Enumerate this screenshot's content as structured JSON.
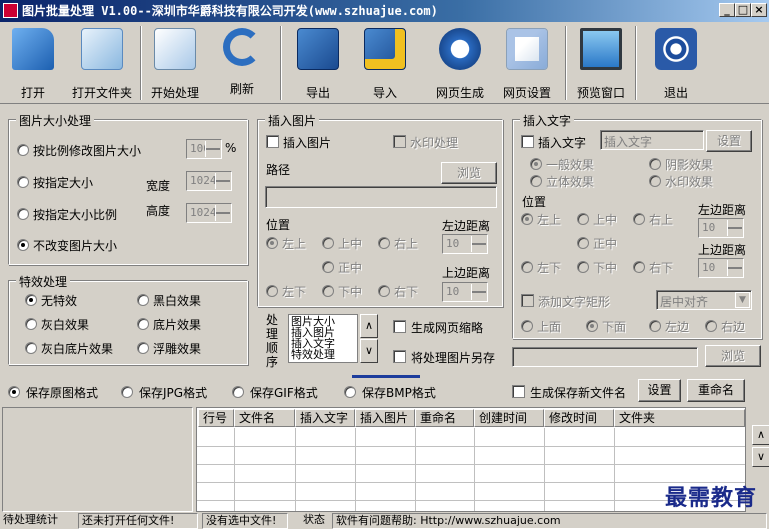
{
  "window": {
    "title": "图片批量处理 V1.00--深圳市华爵科技有限公司开发(www.szhuajue.com)"
  },
  "toolbar": [
    {
      "label": "打开",
      "icon": "open-folder-icon",
      "color": "#2a70c0"
    },
    {
      "label": "打开文件夹",
      "icon": "folder-search-icon",
      "color": "#4a90c8"
    },
    {
      "label": "开始处理",
      "icon": "process-document-icon",
      "color": "#3a7ab8"
    },
    {
      "label": "刷新",
      "icon": "refresh-icon",
      "color": "#2c6ec0"
    },
    {
      "label": "导出",
      "icon": "export-icon",
      "color": "#2a6ab0"
    },
    {
      "label": "导入",
      "icon": "import-icon",
      "color": "#2a6ab0"
    },
    {
      "label": "网页生成",
      "icon": "ie-globe-icon",
      "color": "#2060b0"
    },
    {
      "label": "网页设置",
      "icon": "ie-settings-icon",
      "color": "#2868b8"
    },
    {
      "label": "预览窗口",
      "icon": "monitor-icon",
      "color": "#3a88d0"
    },
    {
      "label": "退出",
      "icon": "exit-icon",
      "color": "#1c4c9c"
    }
  ],
  "size_group": {
    "title": "图片大小处理",
    "opt1": "按比例修改图片大小",
    "opt2": "按指定大小",
    "opt3": "按指定大小比例",
    "opt4": "不改变图片大小",
    "percent_value": "100",
    "percent_unit": "%",
    "width_label": "宽度",
    "width_value": "1024",
    "height_label": "高度",
    "height_value": "1024"
  },
  "effect_group": {
    "title": "特效处理",
    "opts": [
      "无特效",
      "黑白效果",
      "灰白效果",
      "底片效果",
      "灰白底片效果",
      "浮雕效果"
    ]
  },
  "insert_image": {
    "title": "插入图片",
    "checkbox": "插入图片",
    "watermark": "水印处理",
    "path_label": "路径",
    "browse": "浏览",
    "position_label": "位置",
    "positions": [
      "左上",
      "上中",
      "右上",
      "正中",
      "左下",
      "下中",
      "右下"
    ],
    "left_margin_label": "左边距离",
    "left_margin_value": "10",
    "top_margin_label": "上边距离",
    "top_margin_value": "10"
  },
  "insert_text": {
    "title": "插入文字",
    "checkbox": "插入文字",
    "placeholder": "插入文字",
    "settings": "设置",
    "effects": [
      "一般效果",
      "阴影效果",
      "立体效果",
      "水印效果"
    ],
    "position_label": "位置",
    "positions": [
      "左上",
      "上中",
      "右上",
      "正中",
      "左下",
      "下中",
      "右下"
    ],
    "left_margin_label": "左边距离",
    "left_margin_value": "10",
    "top_margin_label": "上边距离",
    "top_margin_value": "10",
    "rect_checkbox": "添加文字矩形",
    "align_value": "居中对齐",
    "rect_positions": [
      "上面",
      "下面",
      "左边",
      "右边"
    ]
  },
  "order": {
    "label": "处理顺序",
    "items": [
      "图片大小",
      "插入图片",
      "插入文字",
      "特效处理"
    ]
  },
  "options": {
    "gen_thumb": "生成网页缩略",
    "save_as": "将处理图片另存",
    "browse": "浏览"
  },
  "format": {
    "opts": [
      "保存原图格式",
      "保存JPG格式",
      "保存GIF格式",
      "保存BMP格式"
    ],
    "new_name": "生成保存新文件名",
    "settings": "设置",
    "rename": "重命名"
  },
  "grid": {
    "columns": [
      "行号",
      "文件名",
      "插入文字",
      "插入图片",
      "重命名",
      "创建时间",
      "修改时间",
      "文件夹"
    ]
  },
  "status": {
    "pending_label": "待处理统计",
    "pending_value": "还未打开任何文件!",
    "selected_value": "没有选中文件!",
    "state_label": "状态",
    "state_value": "软件有问题帮助: Http://www.szhuajue.com"
  },
  "watermark_text": "最需教育"
}
